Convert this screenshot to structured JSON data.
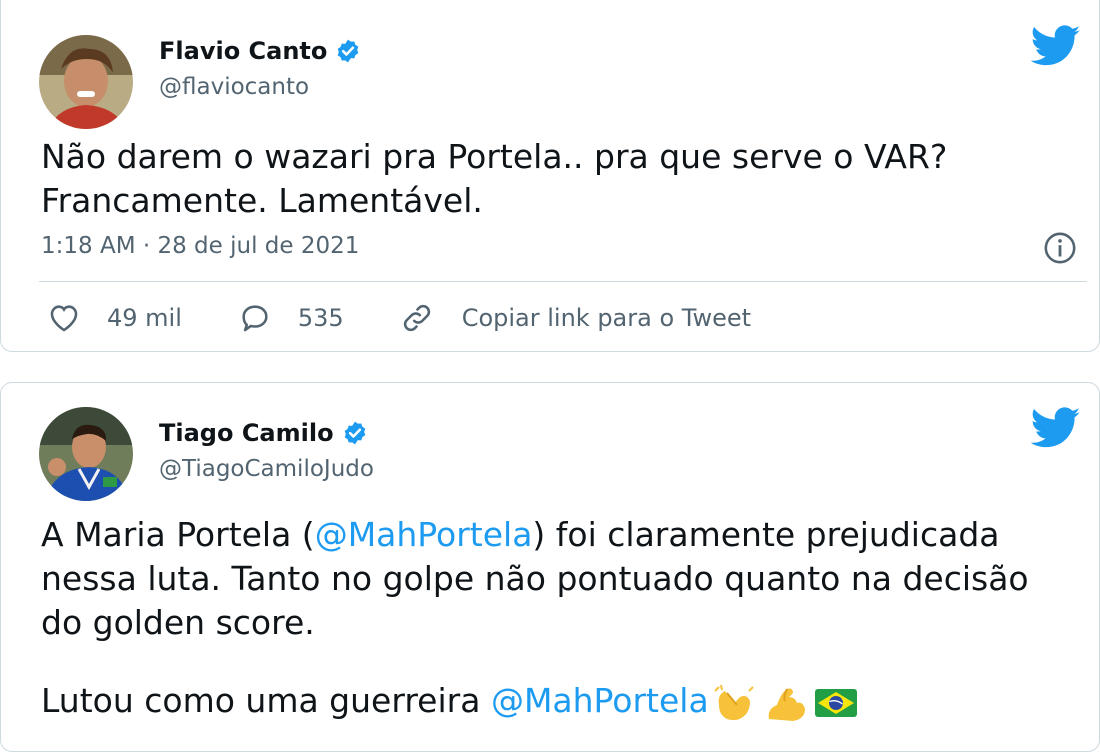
{
  "tweets": [
    {
      "name": "Flavio Canto",
      "handle": "@flaviocanto",
      "text": "Não darem o wazari pra Portela.. pra que serve o VAR? Francamente. Lamentável.",
      "timestamp": "1:18 AM · 28 de jul de 2021",
      "likes": "49 mil",
      "replies": "535",
      "copy_link": "Copiar link para o Tweet",
      "icons": [
        "verified-badge-icon",
        "twitter-bird-icon",
        "info-icon",
        "heart-icon",
        "reply-icon",
        "link-icon"
      ]
    },
    {
      "name": "Tiago Camilo",
      "handle": "@TiagoCamiloJudo",
      "text_p1_a": "A Maria Portela (",
      "text_p1_mention": "@MahPortela",
      "text_p1_b": ") foi claramente prejudicada nessa luta. Tanto no golpe não pontuado quanto na decisão do golden score.",
      "text_p2_a": "Lutou como uma guerreira ",
      "text_p2_mention": "@MahPortela",
      "emojis": [
        "clapping-hands-emoji",
        "flexed-biceps-emoji",
        "brazil-flag-emoji"
      ]
    }
  ],
  "colors": {
    "link": "#1d9bf0",
    "muted": "#536471",
    "border": "#cfd9de",
    "twitter_blue": "#1d9bf0"
  }
}
